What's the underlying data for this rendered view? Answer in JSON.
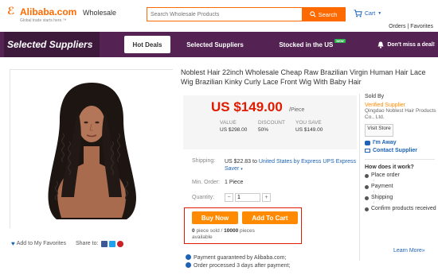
{
  "header": {
    "logo_name": "Alibaba.com",
    "logo_tagline": "Global trade starts here.™",
    "section": "Wholesale",
    "search_placeholder": "Search Wholesale Products",
    "search_button": "Search",
    "cart_label": "Cart",
    "orders_link": "Orders",
    "favorites_link": "Favorites",
    "separator": "|"
  },
  "nav": {
    "brand": "Selected Suppliers",
    "tabs": [
      {
        "label": "Hot Deals"
      },
      {
        "label": "Selected Suppliers"
      },
      {
        "label": "Stocked in the US"
      }
    ],
    "new_badge": "NEW",
    "promo": "Don't miss a deal!"
  },
  "product": {
    "title": "Noblest Hair 22inch Wholesale Cheap Raw Brazilian Virgin Human Hair Lace Wig Brazilian Kinky Curly Lace Front Wig With Baby Hair",
    "price": "US $149.00",
    "price_unit": "/Piece",
    "value_label": "VALUE",
    "value": "US $298.00",
    "discount_label": "DISCOUNT",
    "discount": "50%",
    "save_label": "YOU SAVE",
    "save": "US $149.00",
    "shipping_label": "Shipping:",
    "shipping_cost": "US $22.83 to",
    "shipping_link": "United States by Express UPS Express Saver",
    "min_order_label": "Min. Order:",
    "min_order": "1 Piece",
    "quantity_label": "Quantity:",
    "quantity_value": "1",
    "buy_now": "Buy Now",
    "add_to_cart": "Add To Cart",
    "sold_count": "0",
    "sold_text": "piece sold /",
    "available_count": "10000",
    "available_text": "pieces",
    "available_word": "available",
    "add_favorites": "Add to My Favorites",
    "share_label": "Share to:",
    "guarantee_1": "Payment guaranteed by Alibaba.com;",
    "guarantee_2": "Order processed 3 days after payment;"
  },
  "seller": {
    "sold_by": "Sold By",
    "verified": "Verified Supplier",
    "company": "Qingdao Noblest Hair Products Co., Ltd.",
    "visit_store": "Visit Store",
    "im_away": "I'm Away",
    "contact": "Contact Supplier",
    "how_title": "How does it work?",
    "steps": [
      "Place order",
      "Payment",
      "Shipping",
      "Confirm products received"
    ],
    "learn_more": "Learn More»"
  },
  "colors": {
    "brand_orange": "#ff6a00",
    "nav_purple": "#542353",
    "price_red": "#e01b00",
    "button_orange": "#ff8a00",
    "link_blue": "#1c63b7"
  }
}
